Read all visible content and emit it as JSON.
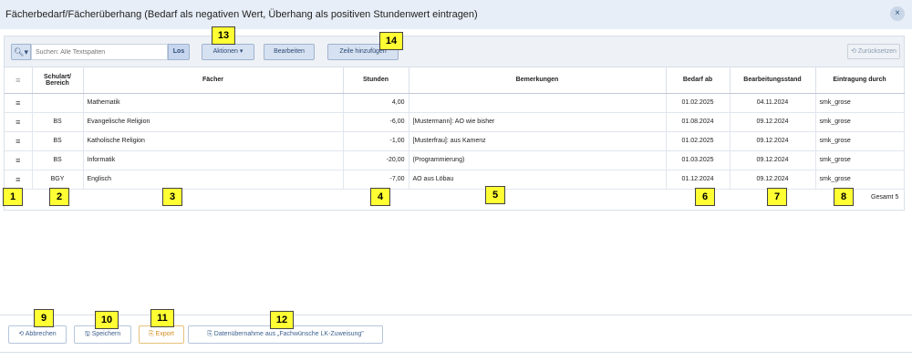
{
  "window": {
    "title": "Fächerbedarf/Fächerüberhang (Bedarf als negativen Wert, Überhang als positiven Stundenwert eintragen)",
    "close_icon": "×"
  },
  "toolbar": {
    "search_icon": "🔍︎▾",
    "search_placeholder": "Suchen: Alle Textspalten",
    "los_label": "Los",
    "aktionen_label": "Aktionen ▾",
    "bearbeiten_label": "Bearbeiten",
    "zeile_label": "Zeile hinzufügen",
    "reset_label": "⟲ Zurücksetzen"
  },
  "table": {
    "headers": [
      "≡",
      "Schulart/ Bereich",
      "Fächer",
      "Stunden",
      "Bemerkungen",
      "Bedarf ab",
      "Bearbeitungsstand",
      "Eintragung durch"
    ],
    "rows": [
      [
        "≡",
        "",
        "Mathematik",
        "4,00",
        "",
        "01.02.2025",
        "04.11.2024",
        "smk_grose"
      ],
      [
        "≡",
        "BS",
        "Evangelische Religion",
        "-6,00",
        "[Mustermann]: AO wie bisher",
        "01.08.2024",
        "09.12.2024",
        "smk_grose"
      ],
      [
        "≡",
        "BS",
        "Katholische Religion",
        "-1,00",
        "[Musterfrau]: aus Kamenz",
        "01.02.2025",
        "09.12.2024",
        "smk_grose"
      ],
      [
        "≡",
        "BS",
        "Informatik",
        "-20,00",
        "(Programmierung)",
        "01.03.2025",
        "09.12.2024",
        "smk_grose"
      ],
      [
        "≡",
        "BGY",
        "Englisch",
        "-7,00",
        "AO aus Löbau",
        "01.12.2024",
        "09.12.2024",
        "smk_grose"
      ]
    ],
    "total": "Gesamt 5"
  },
  "bottom": {
    "abbrechen_label": "⟲ Abbrechen",
    "speichern_label": "🖫 Speichern",
    "export_label": "⎘ Export",
    "datenuebernahme_label": "⎘ Datenübernahme aus „Fachwünsche LK-Zuweisung\""
  },
  "badges": [
    "1",
    "2",
    "3",
    "4",
    "5",
    "6",
    "7",
    "8",
    "9",
    "10",
    "11",
    "12",
    "13",
    "14"
  ]
}
